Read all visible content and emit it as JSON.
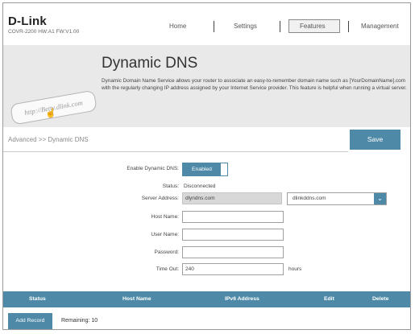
{
  "header": {
    "brand": "D-Link",
    "model": "COVR-2200 HW:A1 FW:V1.00",
    "nav": [
      {
        "label": "Home"
      },
      {
        "label": "Settings"
      },
      {
        "label": "Features",
        "active": true
      },
      {
        "label": "Management"
      }
    ]
  },
  "banner": {
    "title": "Dynamic DNS",
    "description": "Dynamic Domain Name Service allows your router to associate an easy-to-remember domain name such as [YourDomainName].com with the regularly changing IP address assigned by your Internet Service provider. This feature is helpful when running a virtual server.",
    "bubble_text": "http://Betty.dlink.com"
  },
  "breadcrumb": "Advanced >> Dynamic DNS",
  "save_label": "Save",
  "form": {
    "enable_label": "Enable Dynamic DNS:",
    "enable_value": "Enabled",
    "status_label": "Status:",
    "status_value": "Disconnected",
    "server_label": "Server Address:",
    "server_value": "dlyndns.com",
    "server_option": "dlinkddns.com",
    "host_label": "Host Name:",
    "host_value": "",
    "user_label": "User Name:",
    "user_value": "",
    "password_label": "Password:",
    "password_value": "",
    "timeout_label": "Time Out:",
    "timeout_value": "240",
    "timeout_unit": "hours"
  },
  "table": {
    "columns": [
      "Status",
      "Host Name",
      "IPv6 Address",
      "Edit",
      "Delete"
    ]
  },
  "footer": {
    "add_label": "Add Record",
    "remaining_label": "Remaining: 10"
  },
  "colors": {
    "accent": "#4e8aa7",
    "banner_bg": "#e9e9e9"
  }
}
